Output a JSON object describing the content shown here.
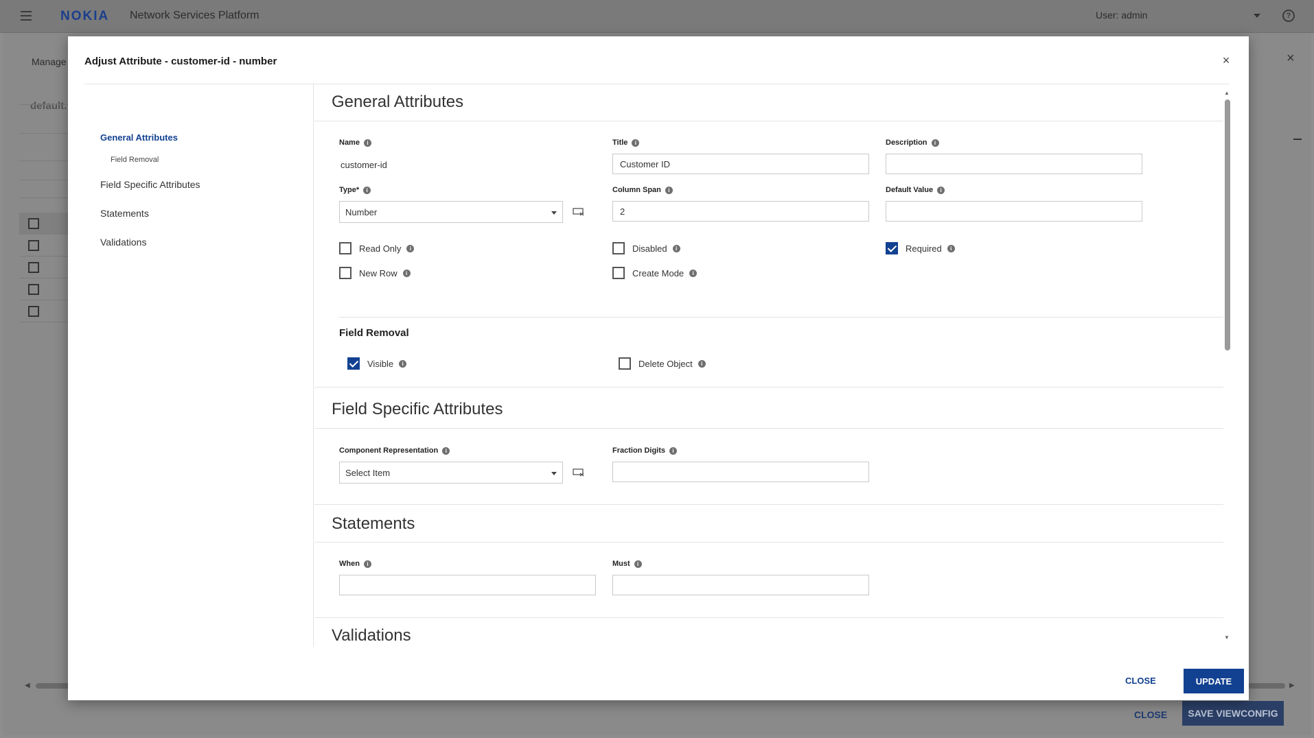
{
  "header": {
    "logo": "NOKIA",
    "product": "Network Services Platform",
    "user": "User: admin"
  },
  "background": {
    "manage_label": "Manage",
    "tab_label": "default.",
    "close_label": "CLOSE",
    "save_label": "SAVE VIEWCONFIG"
  },
  "modal": {
    "title": "Adjust Attribute - customer-id - number",
    "nav": {
      "general": "General Attributes",
      "field_removal": "Field Removal",
      "field_specific": "Field Specific Attributes",
      "statements": "Statements",
      "validations": "Validations"
    },
    "general": {
      "title": "General Attributes",
      "name_label": "Name",
      "name_value": "customer-id",
      "title_label": "Title",
      "title_value": "Customer ID",
      "description_label": "Description",
      "description_value": "",
      "type_label": "Type*",
      "type_value": "Number",
      "column_span_label": "Column Span",
      "column_span_value": "2",
      "default_value_label": "Default Value",
      "default_value_value": "",
      "read_only": "Read Only",
      "disabled": "Disabled",
      "required": "Required",
      "new_row": "New Row",
      "create_mode": "Create Mode"
    },
    "field_removal": {
      "title": "Field Removal",
      "visible": "Visible",
      "delete_object": "Delete Object"
    },
    "field_specific": {
      "title": "Field Specific Attributes",
      "component_label": "Component Representation",
      "component_value": "Select Item",
      "fraction_label": "Fraction Digits",
      "fraction_value": ""
    },
    "statements": {
      "title": "Statements",
      "when_label": "When",
      "when_value": "",
      "must_label": "Must",
      "must_value": ""
    },
    "validations": {
      "title": "Validations"
    },
    "footer": {
      "close": "CLOSE",
      "update": "UPDATE"
    }
  },
  "colors": {
    "primary": "#124191",
    "modal_bg": "#ffffff",
    "overlay": "#8e8e8e"
  }
}
